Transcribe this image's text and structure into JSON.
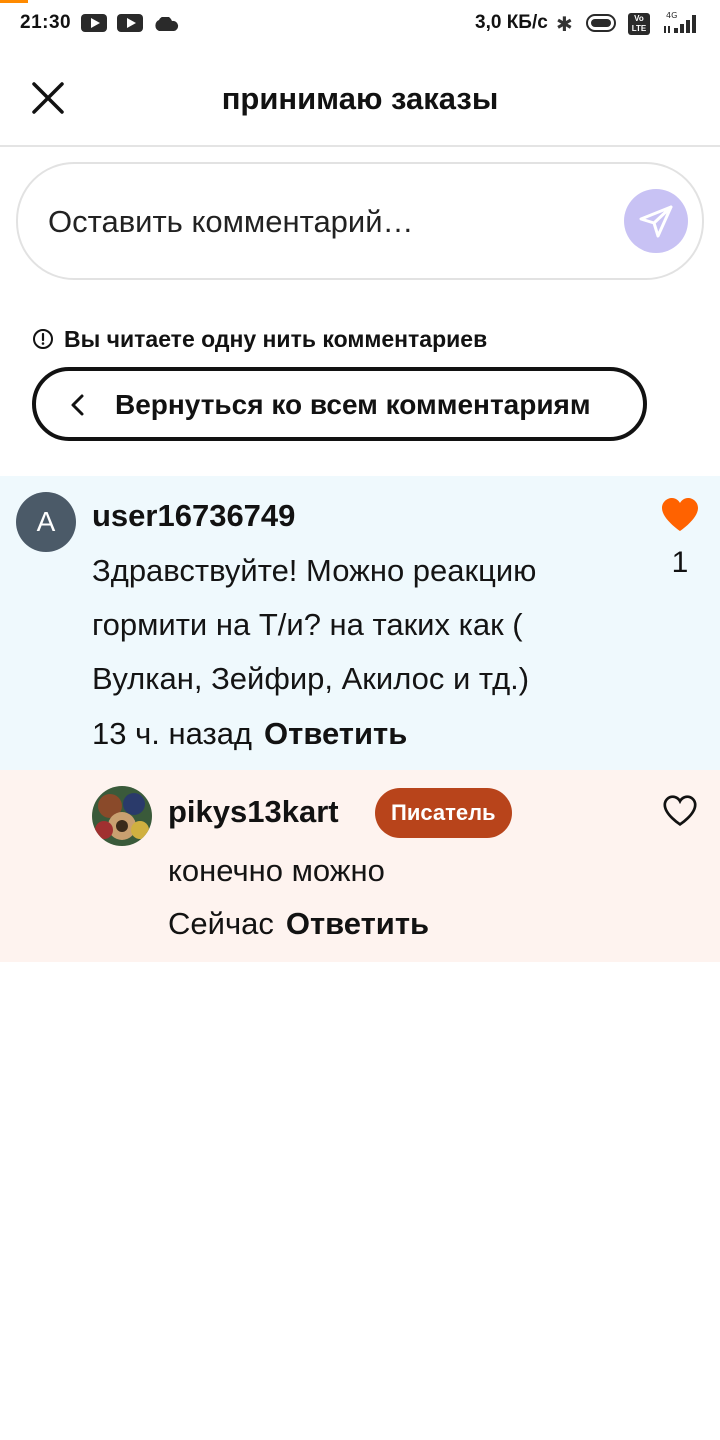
{
  "status_bar": {
    "time": "21:30",
    "network_speed": "3,0 КБ/с",
    "volte_label": "Vo LTE",
    "signal_label": "4G",
    "icons": [
      "youtube-icon",
      "youtube-icon",
      "cloud-icon",
      "bluetooth-icon",
      "battery-icon",
      "volte-icon",
      "signal-icon"
    ]
  },
  "header": {
    "title": "принимаю заказы",
    "close_icon": "close-icon"
  },
  "comment_input": {
    "placeholder": "Оставить комментарий…",
    "send_icon": "send-icon",
    "send_color": "#c8c2f4"
  },
  "thread_notice": {
    "text": "Вы читаете одну нить комментариев",
    "icon": "info-icon"
  },
  "back_button": {
    "label": "Вернуться ко всем комментариям",
    "icon": "chevron-left-icon"
  },
  "comments": [
    {
      "avatar_letter": "A",
      "username": "user16736749",
      "text": "Здравствуйте! Можно реакцию гормити на Т/и? на таких как ( Вулкан, Зейфир, Акилос и тд.)",
      "time": "13 ч. назад",
      "reply_label": "Ответить",
      "likes": "1",
      "liked": true,
      "like_color": "#ff6200",
      "background": "#eff9fd"
    },
    {
      "username": "pikys13kart",
      "badge": "Писатель",
      "badge_color": "#b8441b",
      "text": "конечно можно",
      "time": "Сейчас",
      "reply_label": "Ответить",
      "liked": false,
      "background": "#fef3ef"
    }
  ]
}
